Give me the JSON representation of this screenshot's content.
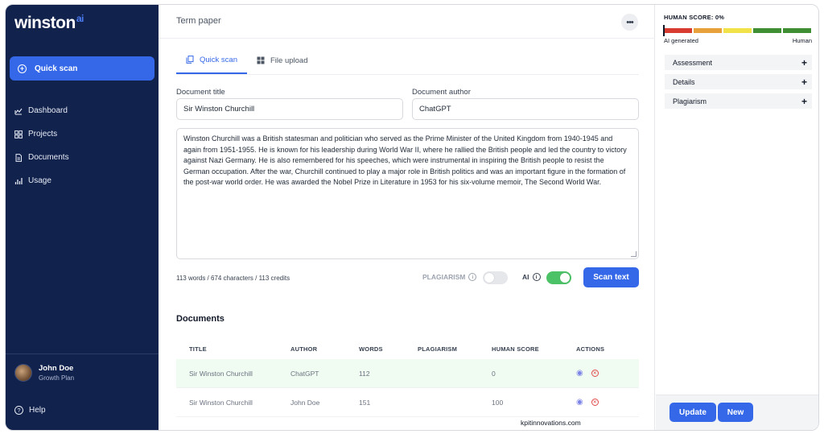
{
  "brand": {
    "name": "winston",
    "suffix": "ai"
  },
  "sidebar": {
    "quick_scan": "Quick scan",
    "items": [
      {
        "label": "Dashboard",
        "icon": "chart-icon"
      },
      {
        "label": "Projects",
        "icon": "grid-icon"
      },
      {
        "label": "Documents",
        "icon": "document-icon"
      },
      {
        "label": "Usage",
        "icon": "bar-chart-icon"
      }
    ],
    "user": {
      "name": "John Doe",
      "plan": "Growth Plan"
    },
    "help": "Help"
  },
  "main": {
    "document_name": "Term paper",
    "more": "•••",
    "tabs": [
      {
        "label": "Quick scan",
        "active": true
      },
      {
        "label": "File upload",
        "active": false
      }
    ],
    "title_label": "Document title",
    "title_value": "Sir Winston Churchill",
    "author_label": "Document author",
    "author_value": "ChatGPT",
    "text": "Winston Churchill was a British statesman and politician who served as the Prime Minister of the United Kingdom from 1940-1945 and again from 1951-1955. He is known for his leadership during World War II, where he rallied the British people and led the country to victory against Nazi Germany. He is also remembered for his speeches, which were instrumental in inspiring the British people to resist the German occupation. After the war, Churchill continued to play a major role in British politics and was an important figure in the formation of the post-war world order. He was awarded the Nobel Prize in Literature in 1953 for his six-volume memoir, The Second World War.",
    "counts": "113 words / 674 characters / 113 credits",
    "plagiarism_label": "PLAGIARISM",
    "plagiarism_on": false,
    "ai_label": "AI",
    "ai_on": true,
    "scan_button": "Scan text",
    "documents_title": "Documents",
    "table": {
      "headers": [
        "TITLE",
        "AUTHOR",
        "WORDS",
        "PLAGIARISM",
        "HUMAN SCORE",
        "ACTIONS"
      ],
      "rows": [
        {
          "title": "Sir Winston Churchill",
          "author": "ChatGPT",
          "words": "112",
          "plagiarism": "",
          "human_score": "0"
        },
        {
          "title": "Sir Winston Churchill",
          "author": "John Doe",
          "words": "151",
          "plagiarism": "",
          "human_score": "100"
        }
      ]
    },
    "watermark": "kpitinnovations.com"
  },
  "right": {
    "human_score_label": "HUMAN SCORE: 0%",
    "scale_colors": [
      "#d83b2f",
      "#e8a13a",
      "#f2e24a",
      "#3f8e34",
      "#3f8e34"
    ],
    "left_label": "AI generated",
    "right_label": "Human",
    "accordions": [
      "Assessment",
      "Details",
      "Plagiarism"
    ],
    "update_button": "Update",
    "new_button": "New"
  },
  "colors": {
    "primary": "#3568e8",
    "sidebar": "#11224d",
    "toggle_on": "#4cc267"
  }
}
